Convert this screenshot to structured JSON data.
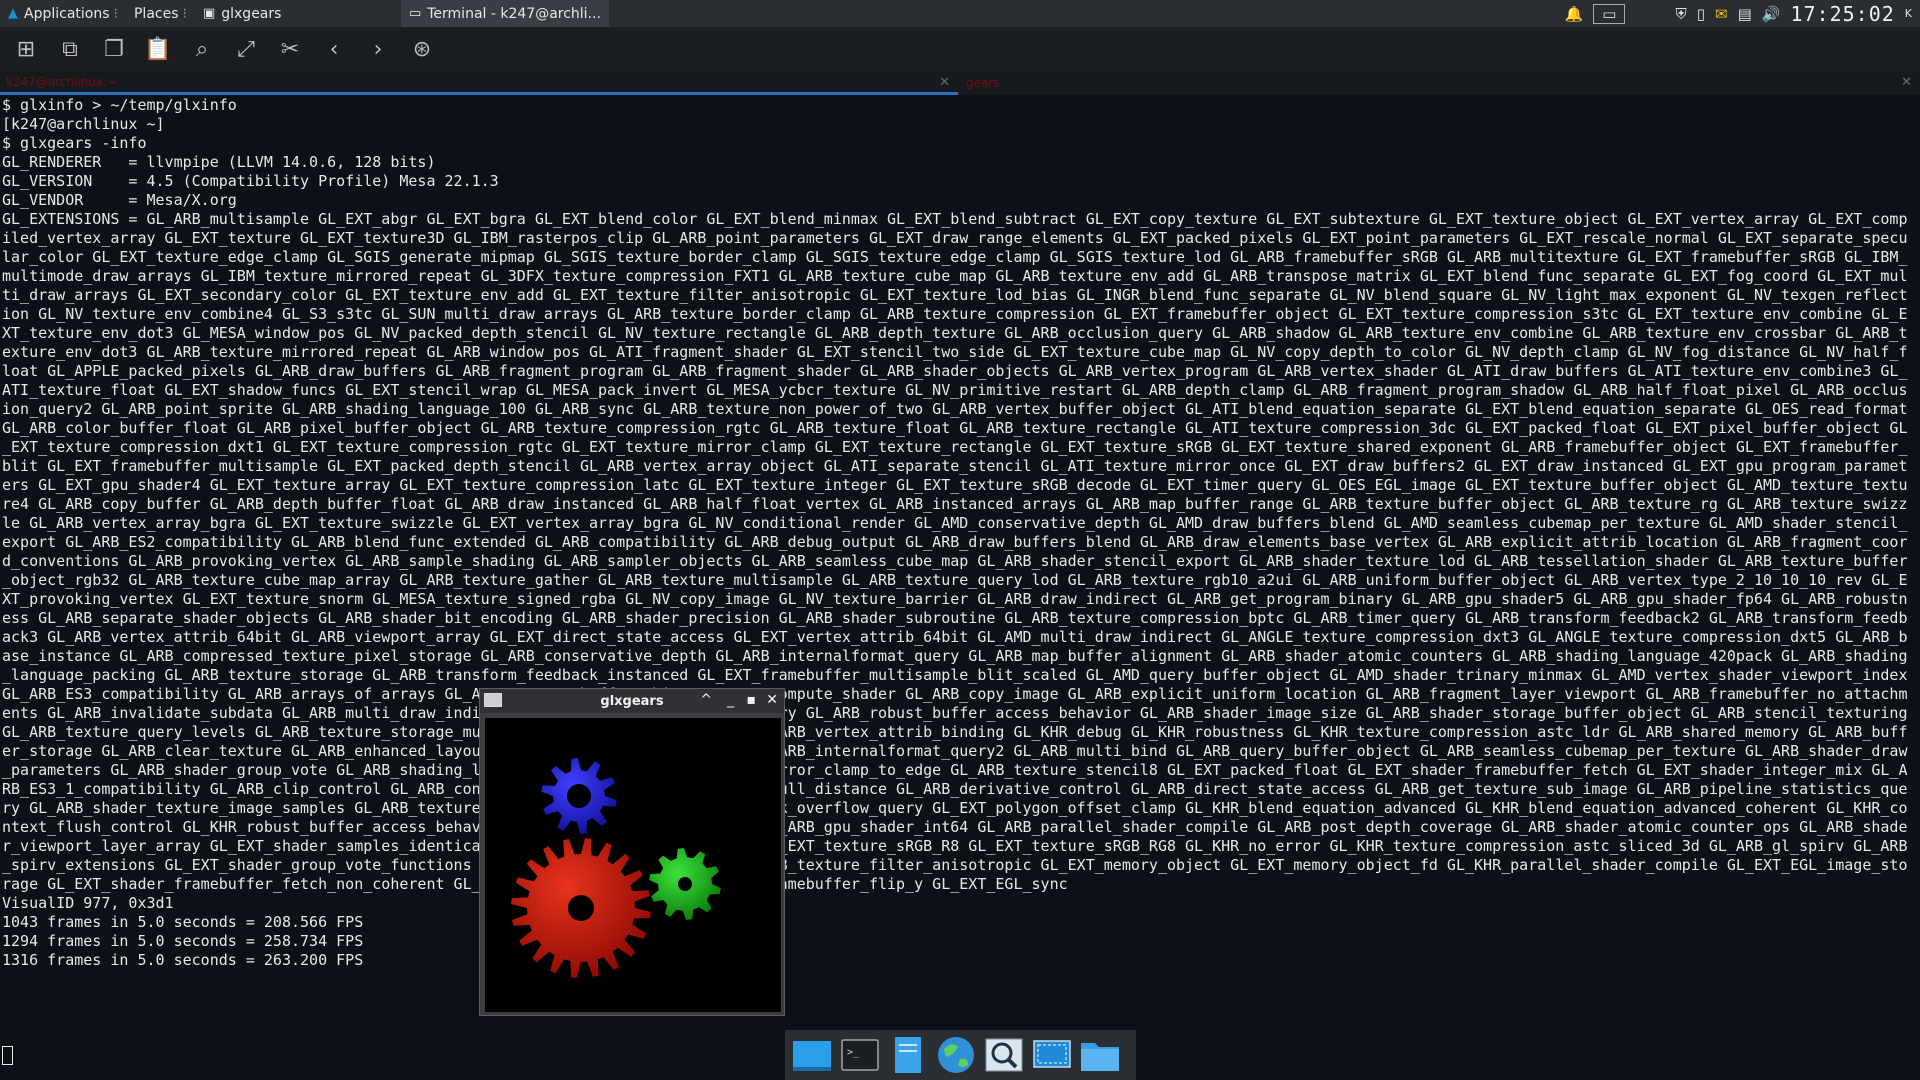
{
  "top_panel": {
    "applications_label": "Applications",
    "places_label": "Places",
    "tasks": [
      {
        "label": "glxgears"
      },
      {
        "label": "Terminal - k247@archli..."
      }
    ],
    "clock": "17:25:02"
  },
  "toolbar": {
    "buttons": [
      "new-tab-icon",
      "new-window-icon",
      "copy-icon",
      "paste-icon",
      "search-icon",
      "fullscreen-icon",
      "preferences-icon",
      "back-icon",
      "forward-icon",
      "help-icon"
    ]
  },
  "tabs": [
    {
      "label": "k247@archlinux:~"
    },
    {
      "label": "gears"
    }
  ],
  "terminal": {
    "lines": [
      "$ glxinfo > ~/temp/glxinfo",
      "[k247@archlinux ~]",
      "$ glxgears -info",
      "GL_RENDERER   = llvmpipe (LLVM 14.0.6, 128 bits)",
      "GL_VERSION    = 4.5 (Compatibility Profile) Mesa 22.1.3",
      "GL_VENDOR     = Mesa/X.org",
      "GL_EXTENSIONS = GL_ARB_multisample GL_EXT_abgr GL_EXT_bgra GL_EXT_blend_color GL_EXT_blend_minmax GL_EXT_blend_subtract GL_EXT_copy_texture GL_EXT_subtexture GL_EXT_texture_object GL_EXT_vertex_array GL_EXT_compiled_vertex_array GL_EXT_texture GL_EXT_texture3D GL_IBM_rasterpos_clip GL_ARB_point_parameters GL_EXT_draw_range_elements GL_EXT_packed_pixels GL_EXT_point_parameters GL_EXT_rescale_normal GL_EXT_separate_specular_color GL_EXT_texture_edge_clamp GL_SGIS_generate_mipmap GL_SGIS_texture_border_clamp GL_SGIS_texture_edge_clamp GL_SGIS_texture_lod GL_ARB_framebuffer_sRGB GL_ARB_multitexture GL_EXT_framebuffer_sRGB GL_IBM_multimode_draw_arrays GL_IBM_texture_mirrored_repeat GL_3DFX_texture_compression_FXT1 GL_ARB_texture_cube_map GL_ARB_texture_env_add GL_ARB_transpose_matrix GL_EXT_blend_func_separate GL_EXT_fog_coord GL_EXT_multi_draw_arrays GL_EXT_secondary_color GL_EXT_texture_env_add GL_EXT_texture_filter_anisotropic GL_EXT_texture_lod_bias GL_INGR_blend_func_separate GL_NV_blend_square GL_NV_light_max_exponent GL_NV_texgen_reflection GL_NV_texture_env_combine4 GL_S3_s3tc GL_SUN_multi_draw_arrays GL_ARB_texture_border_clamp GL_ARB_texture_compression GL_EXT_framebuffer_object GL_EXT_texture_compression_s3tc GL_EXT_texture_env_combine GL_EXT_texture_env_dot3 GL_MESA_window_pos GL_NV_packed_depth_stencil GL_NV_texture_rectangle GL_ARB_depth_texture GL_ARB_occlusion_query GL_ARB_shadow GL_ARB_texture_env_combine GL_ARB_texture_env_crossbar GL_ARB_texture_env_dot3 GL_ARB_texture_mirrored_repeat GL_ARB_window_pos GL_ATI_fragment_shader GL_EXT_stencil_two_side GL_EXT_texture_cube_map GL_NV_copy_depth_to_color GL_NV_depth_clamp GL_NV_fog_distance GL_NV_half_float GL_APPLE_packed_pixels GL_ARB_draw_buffers GL_ARB_fragment_program GL_ARB_fragment_shader GL_ARB_shader_objects GL_ARB_vertex_program GL_ARB_vertex_shader GL_ATI_draw_buffers GL_ATI_texture_env_combine3 GL_ATI_texture_float GL_EXT_shadow_funcs GL_EXT_stencil_wrap GL_MESA_pack_invert GL_MESA_ycbcr_texture GL_NV_primitive_restart GL_ARB_depth_clamp GL_ARB_fragment_program_shadow GL_ARB_half_float_pixel GL_ARB_occlusion_query2 GL_ARB_point_sprite GL_ARB_shading_language_100 GL_ARB_sync GL_ARB_texture_non_power_of_two GL_ARB_vertex_buffer_object GL_ATI_blend_equation_separate GL_EXT_blend_equation_separate GL_OES_read_format GL_ARB_color_buffer_float GL_ARB_pixel_buffer_object GL_ARB_texture_compression_rgtc GL_ARB_texture_float GL_ARB_texture_rectangle GL_ATI_texture_compression_3dc GL_EXT_packed_float GL_EXT_pixel_buffer_object GL_EXT_texture_compression_dxt1 GL_EXT_texture_compression_rgtc GL_EXT_texture_mirror_clamp GL_EXT_texture_rectangle GL_EXT_texture_sRGB GL_EXT_texture_shared_exponent GL_ARB_framebuffer_object GL_EXT_framebuffer_blit GL_EXT_framebuffer_multisample GL_EXT_packed_depth_stencil GL_ARB_vertex_array_object GL_ATI_separate_stencil GL_ATI_texture_mirror_once GL_EXT_draw_buffers2 GL_EXT_draw_instanced GL_EXT_gpu_program_parameters GL_EXT_gpu_shader4 GL_EXT_texture_array GL_EXT_texture_compression_latc GL_EXT_texture_integer GL_EXT_texture_sRGB_decode GL_EXT_timer_query GL_OES_EGL_image GL_EXT_texture_buffer_object GL_AMD_texture_texture4 GL_ARB_copy_buffer GL_ARB_depth_buffer_float GL_ARB_draw_instanced GL_ARB_half_float_vertex GL_ARB_instanced_arrays GL_ARB_map_buffer_range GL_ARB_texture_buffer_object GL_ARB_texture_rg GL_ARB_texture_swizzle GL_ARB_vertex_array_bgra GL_EXT_texture_swizzle GL_EXT_vertex_array_bgra GL_NV_conditional_render GL_AMD_conservative_depth GL_AMD_draw_buffers_blend GL_AMD_seamless_cubemap_per_texture GL_AMD_shader_stencil_export GL_ARB_ES2_compatibility GL_ARB_blend_func_extended GL_ARB_compatibility GL_ARB_debug_output GL_ARB_draw_buffers_blend GL_ARB_draw_elements_base_vertex GL_ARB_explicit_attrib_location GL_ARB_fragment_coord_conventions GL_ARB_provoking_vertex GL_ARB_sample_shading GL_ARB_sampler_objects GL_ARB_seamless_cube_map GL_ARB_shader_stencil_export GL_ARB_shader_texture_lod GL_ARB_tessellation_shader GL_ARB_texture_buffer_object_rgb32 GL_ARB_texture_cube_map_array GL_ARB_texture_gather GL_ARB_texture_multisample GL_ARB_texture_query_lod GL_ARB_texture_rgb10_a2ui GL_ARB_uniform_buffer_object GL_ARB_vertex_type_2_10_10_10_rev GL_EXT_provoking_vertex GL_EXT_texture_snorm GL_MESA_texture_signed_rgba GL_NV_copy_image GL_NV_texture_barrier GL_ARB_draw_indirect GL_ARB_get_program_binary GL_ARB_gpu_shader5 GL_ARB_gpu_shader_fp64 GL_ARB_robustness GL_ARB_separate_shader_objects GL_ARB_shader_bit_encoding GL_ARB_shader_precision GL_ARB_shader_subroutine GL_ARB_texture_compression_bptc GL_ARB_timer_query GL_ARB_transform_feedback2 GL_ARB_transform_feedback3 GL_ARB_vertex_attrib_64bit GL_ARB_viewport_array GL_EXT_direct_state_access GL_EXT_vertex_attrib_64bit GL_AMD_multi_draw_indirect GL_ANGLE_texture_compression_dxt3 GL_ANGLE_texture_compression_dxt5 GL_ARB_base_instance GL_ARB_compressed_texture_pixel_storage GL_ARB_conservative_depth GL_ARB_internalformat_query GL_ARB_map_buffer_alignment GL_ARB_shader_atomic_counters GL_ARB_shading_language_420pack GL_ARB_shading_language_packing GL_ARB_texture_storage GL_ARB_transform_feedback_instanced GL_EXT_framebuffer_multisample_blit_scaled GL_AMD_query_buffer_object GL_AMD_shader_trinary_minmax GL_AMD_vertex_shader_viewport_index GL_ARB_ES3_compatibility GL_ARB_arrays_of_arrays GL_ARB_texture_buffer_object GL_ARB_compute_shader GL_ARB_copy_image GL_ARB_explicit_uniform_location GL_ARB_fragment_layer_viewport GL_ARB_framebuffer_no_attachments GL_ARB_invalidate_subdata GL_ARB_multi_draw_indirect GL_ARB_program_interface_query GL_ARB_robust_buffer_access_behavior GL_ARB_shader_image_size GL_ARB_shader_storage_buffer_object GL_ARB_stencil_texturing GL_ARB_texture_query_levels GL_ARB_texture_storage_multisample GL_ARB_texture_view GL_ARB_vertex_attrib_binding GL_KHR_debug GL_KHR_robustness GL_KHR_texture_compression_astc_ldr GL_ARB_shared_memory GL_ARB_buffer_storage GL_ARB_clear_texture GL_ARB_enhanced_layouts GL_ARB_indirect_parameters GL_ARB_internalformat_query2 GL_ARB_multi_bind GL_ARB_query_buffer_object GL_ARB_seamless_cubemap_per_texture GL_ARB_shader_draw_parameters GL_ARB_shader_group_vote GL_ARB_shading_language_include GL_ARB_texture_mirror_clamp_to_edge GL_ARB_texture_stencil8 GL_EXT_packed_float GL_EXT_shader_framebuffer_fetch GL_EXT_shader_integer_mix GL_ARB_ES3_1_compatibility GL_ARB_clip_control GL_ARB_conditional_render_inverted GL_ARB_cull_distance GL_ARB_derivative_control GL_ARB_direct_state_access GL_ARB_get_texture_sub_image GL_ARB_pipeline_statistics_query GL_ARB_shader_texture_image_samples GL_ARB_texture_barrier GL_ARB_transform_feedback_overflow_query GL_EXT_polygon_offset_clamp GL_KHR_blend_equation_advanced GL_KHR_blend_equation_advanced_coherent GL_KHR_context_flush_control GL_KHR_robust_buffer_access_behavior GL_ARB_ES3_2_compatibility GL_ARB_gpu_shader_int64 GL_ARB_parallel_shader_compile GL_ARB_post_depth_coverage GL_ARB_shader_atomic_counter_ops GL_ARB_shader_viewport_layer_array GL_EXT_shader_samples_identical GL_EXT_texture_filter_minmax GL_EXT_texture_sRGB_R8 GL_EXT_texture_sRGB_RG8 GL_KHR_no_error GL_KHR_texture_compression_astc_sliced_3d GL_ARB_gl_spirv GL_ARB_spirv_extensions GL_EXT_shader_group_vote_functions GL_ARB_polygon_offset_clamp GL_ARB_texture_filter_anisotropic GL_EXT_memory_object GL_EXT_memory_object_fd GL_KHR_parallel_shader_compile GL_EXT_EGL_image_storage GL_EXT_shader_framebuffer_fetch_non_coherent GL_EXT_texture_shadow_lod GL_MESA_framebuffer_flip_y GL_EXT_EGL_sync",
      "VisualID 977, 0x3d1",
      "1043 frames in 5.0 seconds = 208.566 FPS",
      "1294 frames in 5.0 seconds = 258.734 FPS",
      "1316 frames in 5.0 seconds = 263.200 FPS"
    ]
  },
  "glxgears_window": {
    "title": "glxgears",
    "gear_colors": {
      "red": "#c81208",
      "green": "#18b418",
      "blue": "#2020d8"
    }
  },
  "dock": {
    "items": [
      "show-desktop-icon",
      "terminal-icon",
      "file-manager-icon",
      "web-browser-icon",
      "app-finder-icon",
      "screenshot-icon",
      "folder-icon"
    ]
  },
  "colors": {
    "terminal_bg": "#0b1117",
    "panel_bg": "#2a2d31",
    "active_tab_underline": "#2f6fbf"
  }
}
